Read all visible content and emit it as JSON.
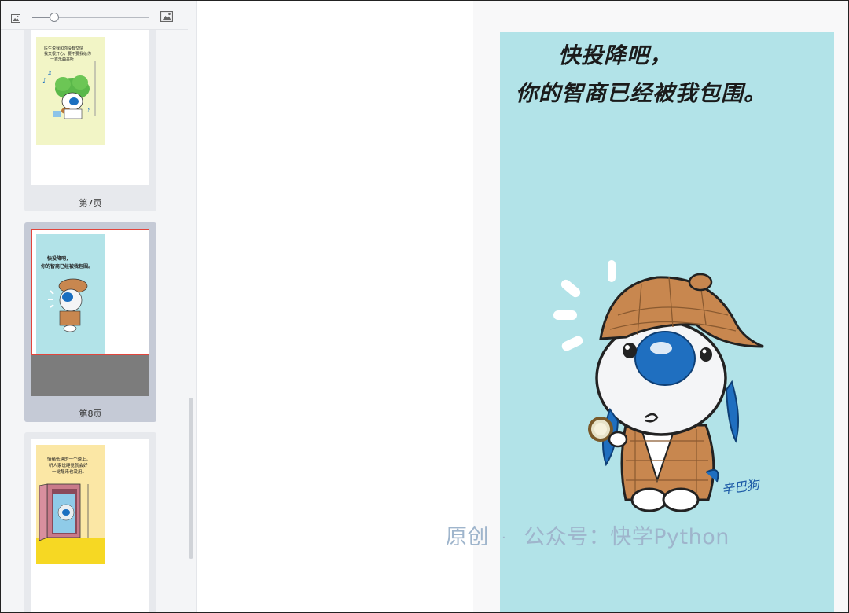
{
  "sidebar": {
    "zoom": {
      "level": 0.18
    },
    "pages": [
      {
        "label": "第7页",
        "selected": false,
        "thumb_caption": "医生说我和你没有交情\n我又很开心，要不要我给你摆\n一首乐曲来听",
        "theme": "yellow"
      },
      {
        "label": "第8页",
        "selected": true,
        "thumb_caption": "快投降吧，\n你的智商已经被我包围。",
        "theme": "blue"
      },
      {
        "label": "",
        "selected": false,
        "thumb_caption": "情绪低落的一个晚上，\n听人家说睡觉就会好\n一觉醒来也没用。",
        "theme": "yellow-pink"
      }
    ]
  },
  "preview": {
    "caption_line1": "快投降吧，",
    "caption_line2": "你的智商已经被我包围。",
    "signature": "辛巴狗",
    "background_color": "#b2e3e8"
  },
  "watermark": {
    "part1": "原创",
    "separator": "·",
    "part2": "公众号：快学Python"
  },
  "icons": {
    "zoom_out": "small-image-icon",
    "zoom_in": "large-image-icon"
  }
}
